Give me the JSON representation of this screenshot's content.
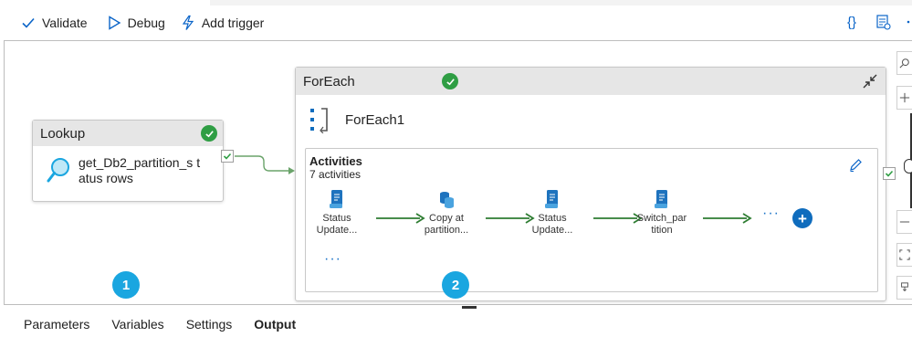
{
  "toolbar": {
    "validate_label": "Validate",
    "debug_label": "Debug",
    "add_trigger_label": "Add trigger",
    "code_icon_text": "{}"
  },
  "lookup": {
    "header": "Lookup",
    "name": "get_Db2_partition_s tatus rows"
  },
  "foreach": {
    "header": "ForEach",
    "name": "ForEach1",
    "activities_title": "Activities",
    "activities_count": "7 activities",
    "nodes": [
      {
        "line1": "Status",
        "line2": "Update..."
      },
      {
        "line1": "Copy at",
        "line2": "partition..."
      },
      {
        "line1": "Status",
        "line2": "Update..."
      },
      {
        "line1": "Switch_par",
        "line2": "tition"
      }
    ],
    "more_dots": "···",
    "bottom_dots": "···",
    "plus": "+"
  },
  "badges": [
    "1",
    "2"
  ],
  "tabs": [
    {
      "label": "Parameters",
      "active": false
    },
    {
      "label": "Variables",
      "active": false
    },
    {
      "label": "Settings",
      "active": false
    },
    {
      "label": "Output",
      "active": true
    }
  ],
  "colors": {
    "success": "#2f9e44",
    "accent": "#0f6cbd",
    "badge": "#1aa6e0",
    "flow_arrow": "#2e7d32"
  }
}
